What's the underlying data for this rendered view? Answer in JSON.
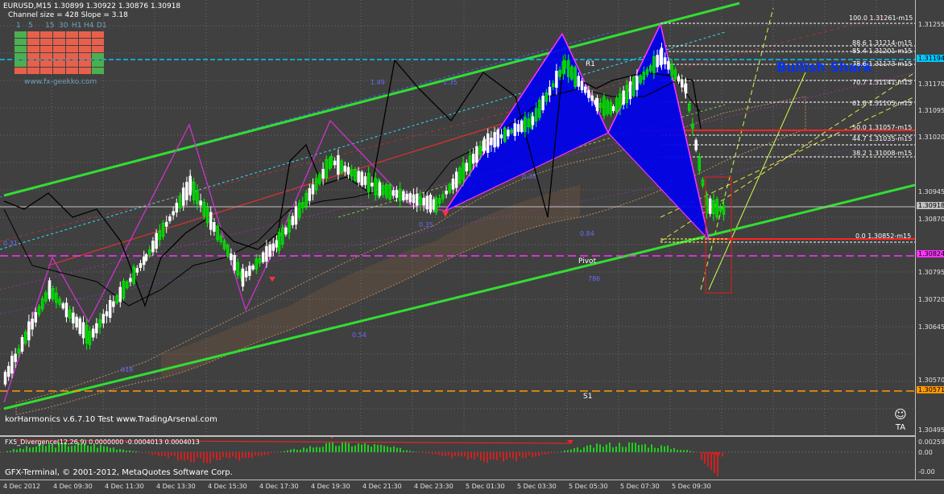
{
  "header": {
    "symbol_line": "EURUSD,M15  1.30899 1.30922 1.30876 1.30918",
    "channel_line": "Channel size = 428 Slope = 3.18"
  },
  "timeframe_panel": {
    "labels": [
      "1",
      "5",
      "15",
      "30",
      "H1",
      "H4",
      "D1"
    ],
    "website": "www.fx-geekko.com"
  },
  "pattern": {
    "name": "Bullish Shark",
    "r1": "R1",
    "pivot": "Pivot",
    "s1": "S1"
  },
  "fib_levels": [
    {
      "label": "100.0 1.31261-m15"
    },
    {
      "label": "88.6 1.31214-m15"
    },
    {
      "label": "85.4 1.31201-m15"
    },
    {
      "label": "78.6 1.31173-m15"
    },
    {
      "label": "70.7 1.31141-m15"
    },
    {
      "label": "61.8 1.31105-m15"
    },
    {
      "label": "50.0 1.31057-m15"
    },
    {
      "label": "44.7 1.31035-m15"
    },
    {
      "label": "38.2 1.31008-m15"
    },
    {
      "label": "0.0 1.30852-m15"
    }
  ],
  "price_axis": {
    "ticks": [
      "1.31255",
      "1.31170",
      "1.31095",
      "1.31020",
      "1.30945",
      "1.30870",
      "1.30795",
      "1.30720",
      "1.30645",
      "1.30570",
      "1.30495"
    ],
    "tags": [
      {
        "text": "1.31194",
        "color": "#00c8ff"
      },
      {
        "text": "1.30918",
        "color": "#c0c0c0"
      },
      {
        "text": "1.30824",
        "color": "#ff33ff"
      },
      {
        "text": "1.30571",
        "color": "#ff9900"
      }
    ]
  },
  "chart_labels": {
    "small_r": [
      "1.49",
      "0.35",
      "0.84",
      "1.35",
      "0.31",
      "0.38",
      "0.54",
      "786",
      "618"
    ]
  },
  "footer": {
    "harmonics": "korHarmonics v.6.7.10 Test www.TradingArsenal.com",
    "copyright": "GFX-Terminal, © 2001-2012, MetaQuotes Software Corp."
  },
  "sub_window": {
    "title": "FX5_Divergence(12,26,9) 0.0000000 -0.0004013 0.0004013",
    "ticks": [
      "0.00259",
      "0.00",
      "-0.00"
    ]
  },
  "time_axis": {
    "ticks": [
      "4 Dec 2012",
      "4 Dec 09:30",
      "4 Dec 11:30",
      "4 Dec 13:30",
      "4 Dec 15:30",
      "4 Dec 17:30",
      "4 Dec 19:30",
      "4 Dec 21:30",
      "4 Dec 23:30",
      "5 Dec 01:30",
      "5 Dec 03:30",
      "5 Dec 05:30",
      "5 Dec 07:30",
      "5 Dec 09:30"
    ]
  },
  "colors": {
    "background": "#404040",
    "bull_candle": "#00ff00",
    "bear_candle": "#ffffff",
    "channel": "#33dd33",
    "pattern_fill": "#0000ee",
    "pivot": "#ff33ff",
    "s1": "#ff9900"
  }
}
